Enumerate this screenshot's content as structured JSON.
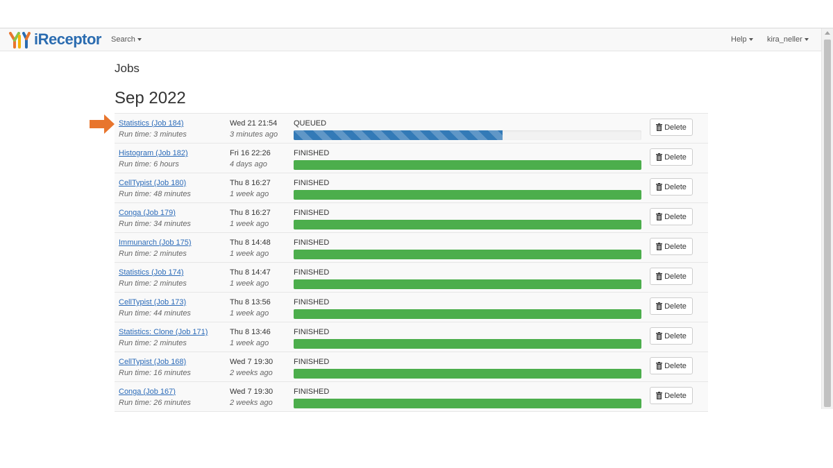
{
  "app": {
    "logo_text": "iReceptor"
  },
  "navbar": {
    "search_label": "Search",
    "help_label": "Help",
    "user_label": "kira_neller"
  },
  "page": {
    "title": "Jobs",
    "month": "Sep 2022"
  },
  "colors": {
    "accent": "#337ab7",
    "finished": "#4cae4c",
    "arrow": "#e8752d",
    "link": "#2a6ab8"
  },
  "delete_label": "Delete",
  "jobs": [
    {
      "name": "Statistics (Job 184)",
      "runtime": "Run time: 3 minutes",
      "date": "Wed 21 21:54",
      "ago": "3 minutes ago",
      "status": "QUEUED",
      "progress": 0.6
    },
    {
      "name": "Histogram (Job 182)",
      "runtime": "Run time: 6 hours",
      "date": "Fri 16 22:26",
      "ago": "4 days ago",
      "status": "FINISHED",
      "progress": 1.0
    },
    {
      "name": "CellTypist (Job 180)",
      "runtime": "Run time: 48 minutes",
      "date": "Thu 8 16:27",
      "ago": "1 week ago",
      "status": "FINISHED",
      "progress": 1.0
    },
    {
      "name": "Conga (Job 179)",
      "runtime": "Run time: 34 minutes",
      "date": "Thu 8 16:27",
      "ago": "1 week ago",
      "status": "FINISHED",
      "progress": 1.0
    },
    {
      "name": "Immunarch (Job 175)",
      "runtime": "Run time: 2 minutes",
      "date": "Thu 8 14:48",
      "ago": "1 week ago",
      "status": "FINISHED",
      "progress": 1.0
    },
    {
      "name": "Statistics (Job 174)",
      "runtime": "Run time: 2 minutes",
      "date": "Thu 8 14:47",
      "ago": "1 week ago",
      "status": "FINISHED",
      "progress": 1.0
    },
    {
      "name": "CellTypist (Job 173)",
      "runtime": "Run time: 44 minutes",
      "date": "Thu 8 13:56",
      "ago": "1 week ago",
      "status": "FINISHED",
      "progress": 1.0
    },
    {
      "name": "Statistics: Clone (Job 171)",
      "runtime": "Run time: 2 minutes",
      "date": "Thu 8 13:46",
      "ago": "1 week ago",
      "status": "FINISHED",
      "progress": 1.0
    },
    {
      "name": "CellTypist (Job 168)",
      "runtime": "Run time: 16 minutes",
      "date": "Wed 7 19:30",
      "ago": "2 weeks ago",
      "status": "FINISHED",
      "progress": 1.0
    },
    {
      "name": "Conga (Job 167)",
      "runtime": "Run time: 26 minutes",
      "date": "Wed 7 19:30",
      "ago": "2 weeks ago",
      "status": "FINISHED",
      "progress": 1.0
    }
  ]
}
